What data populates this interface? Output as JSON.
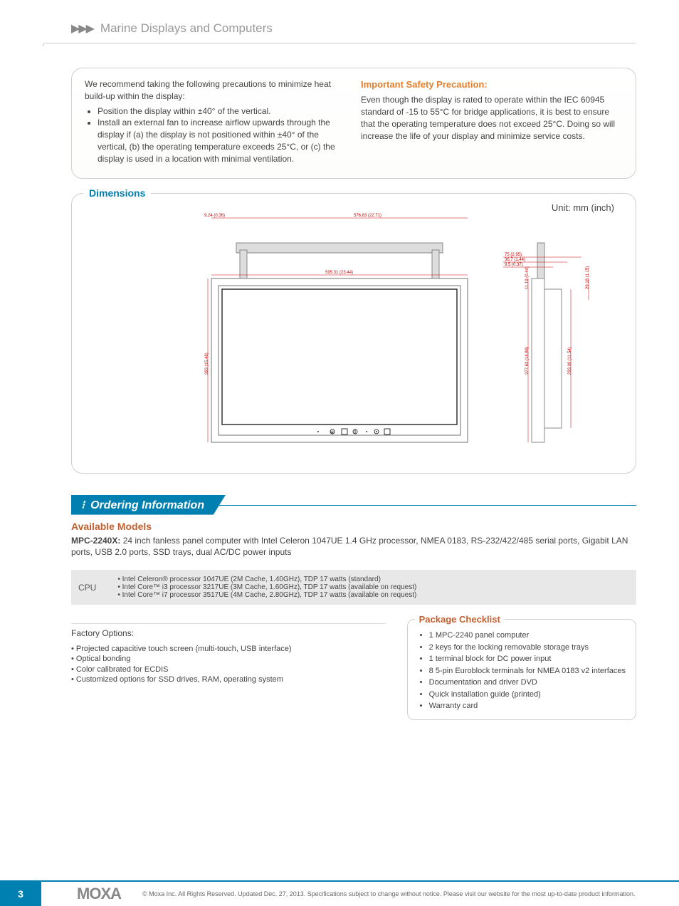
{
  "header": {
    "breadcrumb": "Marine Displays and Computers"
  },
  "precautions": {
    "intro": "We recommend taking the following precautions to minimize heat build-up within the display:",
    "bullets": [
      "Position the display within ±40° of the vertical.",
      "Install an external fan to increase airflow upwards through the display if (a) the display is not positioned within ±40° of the vertical, (b) the operating temperature exceeds 25°C, or (c) the display is used in a location with minimal ventilation."
    ],
    "safety_title": "Important Safety Precaution:",
    "safety_body": "Even though the display is rated to operate within the IEC 60945 standard of -15 to 55°C for bridge applications, it is best to ensure that the operating temperature does not exceed 25°C. Doing so will increase the life of your display and minimize service costs."
  },
  "dimensions": {
    "title": "Dimensions",
    "unit_label": "Unit: mm (inch)",
    "labels": {
      "top_w1": "9.24 (0.36)",
      "top_w2": "576.83 (22.71)",
      "mid_w": "595.31 (23.44)",
      "side_h1": "393 (15.48)",
      "side_d1": "75 (2.95)",
      "side_d2": "36.7 (1.44)",
      "side_d3": "9.5 (0.37)",
      "side_t1": "11.19 (0.44)",
      "side_t2": "29.18 (1.15)",
      "side_h2": "377.63 (14.84)",
      "side_h3": "293.09 (11.54)"
    }
  },
  "ordering": {
    "bar_title": "Ordering Information",
    "models_title": "Available Models",
    "model_name": "MPC-2240X:",
    "model_desc": "24 inch fanless panel computer with Intel Celeron 1047UE 1.4 GHz processor, NMEA 0183, RS-232/422/485 serial ports, Gigabit LAN ports, USB 2.0 ports, SSD trays, dual AC/DC power inputs",
    "cpu_label": "CPU",
    "cpu_lines": [
      "• Intel Celeron® processor 1047UE (2M Cache, 1.40GHz), TDP 17 watts (standard)",
      "• Intel Core™ i3 processor 3217UE (3M Cache, 1.60GHz), TDP 17 watts (available on request)",
      "• Intel Core™ i7 processor 3517UE (4M Cache, 2.80GHz), TDP 17 watts (available on request)"
    ],
    "factory_title": "Factory Options:",
    "factory_lines": [
      "• Projected capacitive touch screen (multi-touch, USB interface)",
      "• Optical bonding",
      "• Color calibrated for ECDIS",
      "• Customized options for SSD drives, RAM, operating system"
    ],
    "checklist_title": "Package Checklist",
    "checklist": [
      "1 MPC-2240  panel computer",
      "2 keys for the locking removable storage trays",
      "1 terminal block for DC power input",
      "8 5-pin Euroblock terminals for NMEA 0183 v2 interfaces",
      "Documentation and driver DVD",
      "Quick installation guide (printed)",
      "Warranty card"
    ]
  },
  "footer": {
    "page": "3",
    "logo": "MOXA",
    "copyright": "© Moxa Inc. All Rights Reserved. Updated Dec. 27, 2013. Specifications subject to change without notice. Please visit our website for the most up-to-date product information."
  }
}
